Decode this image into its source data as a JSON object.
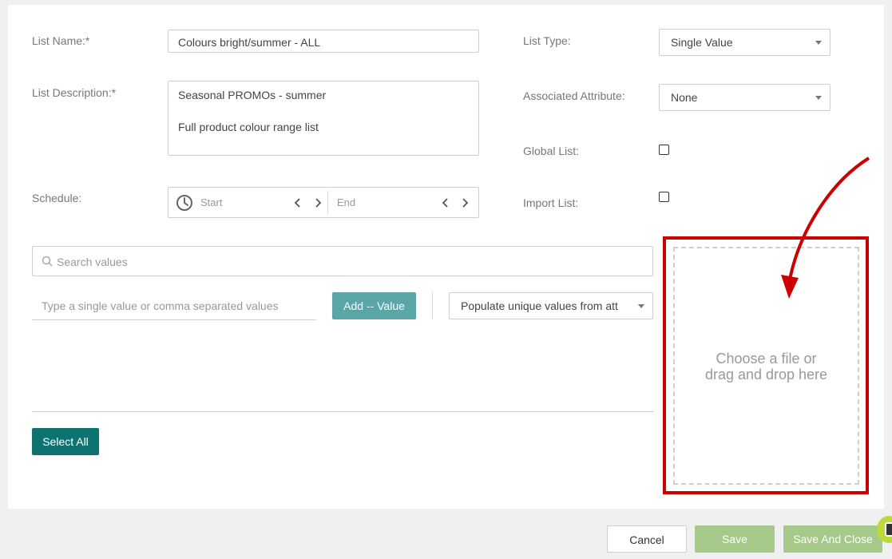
{
  "form": {
    "list_name_label": "List Name:*",
    "list_name_value": "Colours bright/summer - ALL",
    "list_description_label": "List Description:*",
    "list_description_line1": "Seasonal PROMOs - summer",
    "list_description_line2": "Full product colour range list",
    "schedule_label": "Schedule:",
    "schedule_start_placeholder": "Start",
    "schedule_end_placeholder": "End",
    "list_type_label": "List Type:",
    "list_type_value": "Single Value",
    "associated_attribute_label": "Associated Attribute:",
    "associated_attribute_value": "None",
    "global_list_label": "Global List:",
    "global_list_checked": false,
    "import_list_label": "Import List:",
    "import_list_checked": false
  },
  "values": {
    "search_placeholder": "Search values",
    "value_input_placeholder": "Type a single value or comma separated values",
    "add_button_label": "Add -- Value",
    "populate_select_value": "Populate unique values from att",
    "select_all_label": "Select All"
  },
  "dropzone": {
    "line1": "Choose a file or",
    "line2": "drag and drop here"
  },
  "footer": {
    "cancel_label": "Cancel",
    "save_label": "Save",
    "save_close_label": "Save And Close"
  },
  "colors": {
    "teal_dark": "#0d7371",
    "teal_light": "#5aa6a6",
    "green_disabled": "#a6c98a",
    "highlight_red": "#c00000"
  }
}
